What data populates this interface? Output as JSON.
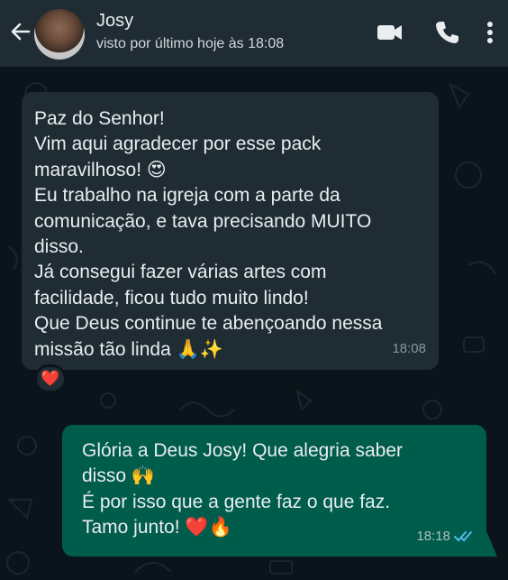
{
  "header": {
    "contact_name": "Josy",
    "status": "visto por último hoje às 18:08"
  },
  "messages": [
    {
      "direction": "incoming",
      "lines": [
        "Paz do Senhor!",
        "Vim aqui agradecer por esse pack",
        "maravilhoso! 😍",
        "Eu trabalho na igreja com a parte da",
        "comunicação, e tava precisando MUITO",
        "disso.",
        "Já consegui fazer várias artes com",
        "facilidade, ficou tudo muito lindo!",
        "Que Deus continue te abençoando nessa",
        "missão tão linda 🙏✨"
      ],
      "time": "18:08",
      "reaction": "❤️"
    },
    {
      "direction": "outgoing",
      "lines": [
        "Glória a Deus Josy! Que alegria saber",
        "disso 🙌",
        "É por isso que a gente faz o que faz.",
        "Tamo junto! ❤️🔥"
      ],
      "time": "18:18",
      "status_icon": "double-check-read-icon"
    }
  ],
  "colors": {
    "header_bg": "#1f2c34",
    "chat_bg": "#0b141a",
    "incoming_bubble": "#1f2c34",
    "outgoing_bubble": "#005c4b",
    "read_tick": "#53bdeb"
  }
}
